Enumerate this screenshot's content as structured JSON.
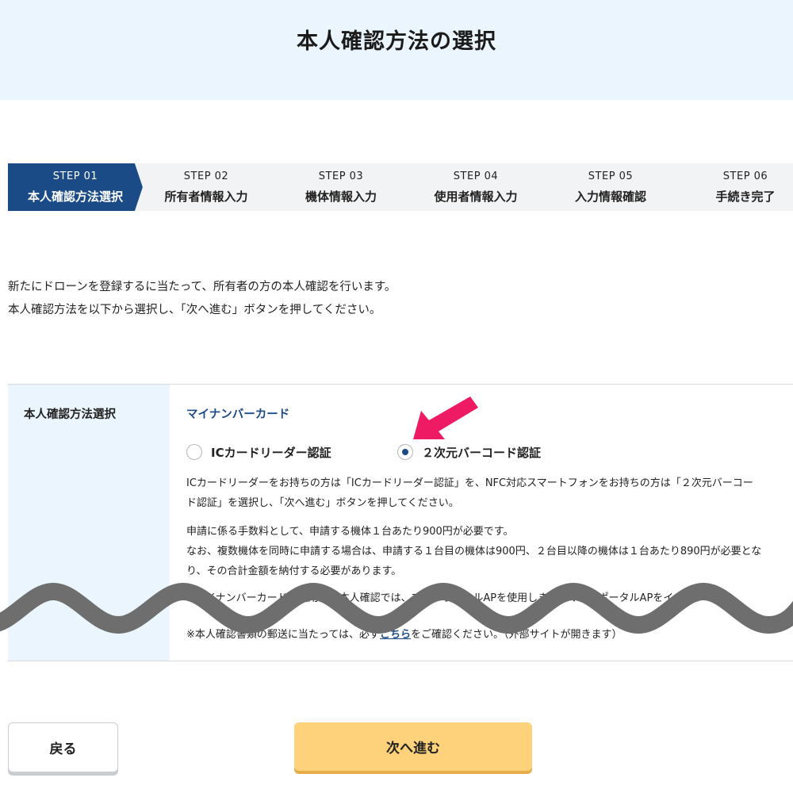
{
  "header": {
    "title": "本人確認方法の選択"
  },
  "steps": [
    {
      "num": "STEP 01",
      "label": "本人確認方法選択"
    },
    {
      "num": "STEP 02",
      "label": "所有者情報入力"
    },
    {
      "num": "STEP 03",
      "label": "機体情報入力"
    },
    {
      "num": "STEP 04",
      "label": "使用者情報入力"
    },
    {
      "num": "STEP 05",
      "label": "入力情報確認"
    },
    {
      "num": "STEP 06",
      "label": "手続き完了"
    }
  ],
  "intro": {
    "line1": "新たにドローンを登録するに当たって、所有者の方の本人確認を行います。",
    "line2": "本人確認方法を以下から選択し、「次へ進む」ボタンを押してください。"
  },
  "form": {
    "label": "本人確認方法選択",
    "card_title": "マイナンバーカード",
    "option_ic": "ICカードリーダー認証",
    "option_barcode": "２次元バーコード認証",
    "selected": "option_barcode",
    "desc1_line1": "ICカードリーダーをお持ちの方は「ICカードリーダー認証」を、NFC対応スマートフォンをお持ちの方は「２次元バーコー",
    "desc1_line2": "ド認証」を選択し、「次へ進む」ボタンを押してください。",
    "desc2_line1": "申請に係る手数料として、申請する機体１台あたり900円が必要です。",
    "desc2_line2": "なお、複数機体を同時に申請する場合は、申請する１台目の機体は900円、２台目以降の機体は１台あたり890円が必要とな",
    "desc2_line3": "り、その合計金額を納付する必要があります。",
    "note1": "※マイナンバーカードを使用した本人確認では、マイナポータルAPを使用します。マイナポータルAPをインストー",
    "note2_before": "※本人確認書類の郵送に当たっては、必ず",
    "note2_link": "こちら",
    "note2_after": "をご確認ください。（外部サイトが開きます）"
  },
  "buttons": {
    "back": "戻る",
    "next": "次へ進む"
  },
  "colors": {
    "accent": "#1b4b87",
    "header_bg": "#eaf5fd",
    "next_button": "#fdd27a",
    "arrow": "#ef1a64"
  }
}
